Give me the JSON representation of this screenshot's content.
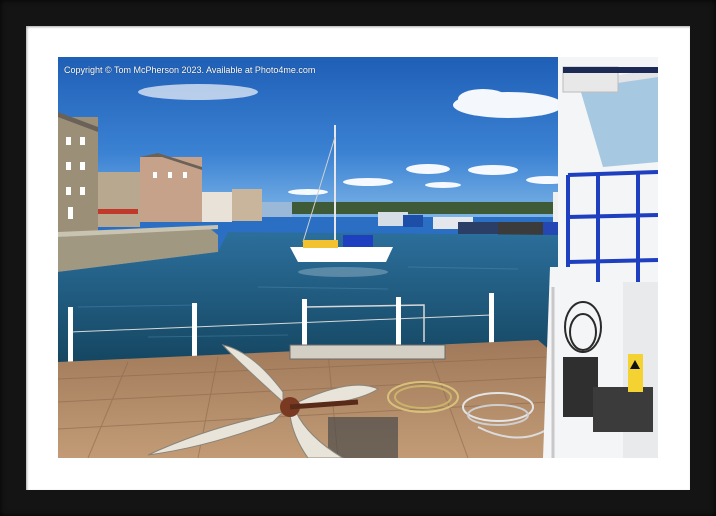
{
  "frame": {
    "color": "#141414",
    "mount_color": "#ffffff"
  },
  "photo": {
    "copyright": "Copyright © Tom McPherson 2023. Available at Photo4me.com",
    "colors": {
      "sky": "#2a6fc4",
      "water": "#1f5a86",
      "deck": "#b08a66",
      "boat_hull": "#ffffff",
      "boat_trim": "#1e3fbf"
    }
  }
}
